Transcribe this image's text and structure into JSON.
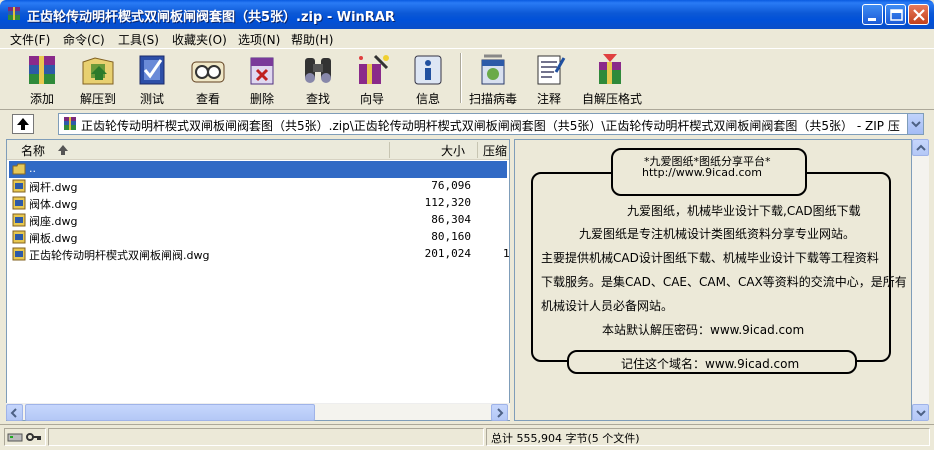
{
  "window": {
    "title": "正齿轮传动明杆楔式双闸板闸阀套图（共5张）.zip - WinRAR",
    "minimize_label": "_",
    "maximize_label": "□",
    "close_label": "×"
  },
  "menu": [
    {
      "label": "文件(F)"
    },
    {
      "label": "命令(C)"
    },
    {
      "label": "工具(S)"
    },
    {
      "label": "收藏夹(O)"
    },
    {
      "label": "选项(N)"
    },
    {
      "label": "帮助(H)"
    }
  ],
  "toolbar": [
    {
      "label": "添加",
      "icon": "add-archive-icon"
    },
    {
      "label": "解压到",
      "icon": "extract-to-icon"
    },
    {
      "label": "测试",
      "icon": "test-icon"
    },
    {
      "label": "查看",
      "icon": "view-icon"
    },
    {
      "label": "删除",
      "icon": "delete-icon"
    },
    {
      "label": "查找",
      "icon": "find-icon"
    },
    {
      "label": "向导",
      "icon": "wizard-icon"
    },
    {
      "label": "信息",
      "icon": "info-icon"
    },
    {
      "label": "扫描病毒",
      "icon": "virus-scan-icon"
    },
    {
      "label": "注释",
      "icon": "comment-icon"
    },
    {
      "label": "自解压格式",
      "icon": "sfx-icon"
    }
  ],
  "address": {
    "path": "正齿轮传动明杆楔式双闸板闸阀套图（共5张）.zip\\正齿轮传动明杆楔式双闸板闸阀套图（共5张）\\正齿轮传动明杆楔式双闸板闸阀套图（共5张） - ZIP 压"
  },
  "columns": {
    "name": "名称",
    "size": "大小",
    "ratio": "压缩"
  },
  "files": [
    {
      "name": "..",
      "size": "",
      "ratio": "",
      "type": "parent-folder"
    },
    {
      "name": "阀杆.dwg",
      "size": "76,096",
      "ratio": "",
      "type": "dwg"
    },
    {
      "name": "阀体.dwg",
      "size": "112,320",
      "ratio": "",
      "type": "dwg"
    },
    {
      "name": "阀座.dwg",
      "size": "86,304",
      "ratio": "",
      "type": "dwg"
    },
    {
      "name": "闸板.dwg",
      "size": "80,160",
      "ratio": "",
      "type": "dwg"
    },
    {
      "name": "正齿轮传动明杆楔式双闸板闸阀.dwg",
      "size": "201,024",
      "ratio": "1",
      "type": "dwg"
    }
  ],
  "comment": {
    "header_line1": "*九爱图纸*图纸分享平台*",
    "header_line2": "http://www.9icad.com",
    "lines": [
      "九爱图纸，机械毕业设计下载,CAD图纸下载",
      "九爱图纸是专注机械设计类图纸资料分享专业网站。",
      "主要提供机械CAD设计图纸下载、机械毕业设计下载等工程资料",
      "下载服务。是集CAD、CAE、CAM、CAX等资料的交流中心，是所有",
      "机械设计人员必备网站。",
      "本站默认解压密码：www.9icad.com"
    ],
    "footer": "记住这个域名：www.9icad.com"
  },
  "status": {
    "summary": "总计 555,904 字节(5 个文件)"
  }
}
